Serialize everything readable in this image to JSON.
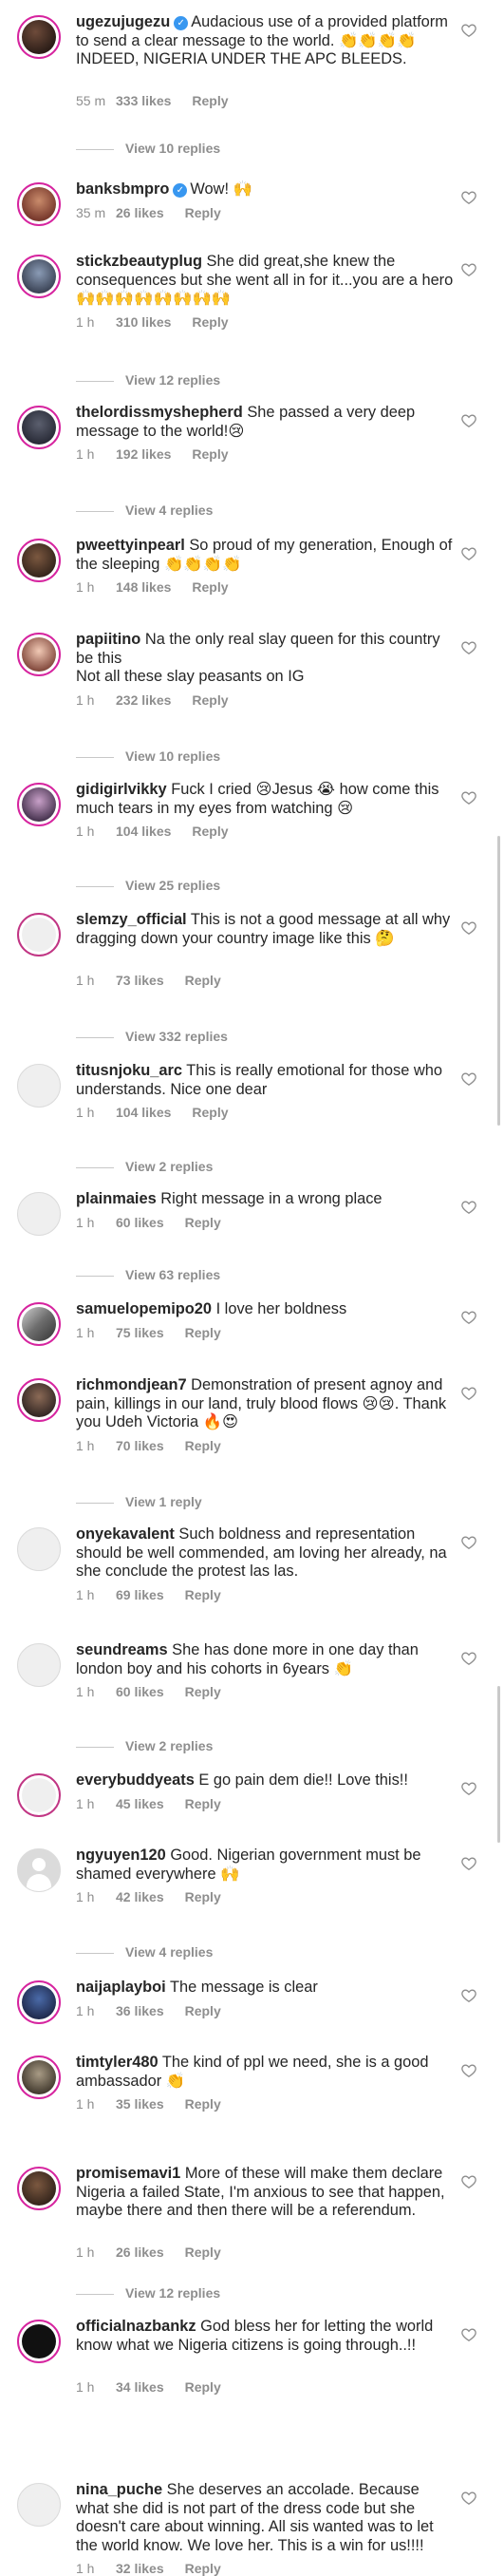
{
  "comments": [
    {
      "username": "ugezujugezu",
      "verified": true,
      "text": "Audacious use of a provided platform to send a clear message to the world. 👏👏👏👏 INDEED, NIGERIA UNDER THE APC BLEEDS.",
      "time": "55 m",
      "likes": "333 likes",
      "reply": "Reply",
      "view_replies": "View 10 replies",
      "avatar": "profile-photo"
    },
    {
      "username": "banksbmpro",
      "verified": true,
      "text": "Wow! 🙌",
      "time": "35 m",
      "likes": "26 likes",
      "reply": "Reply",
      "view_replies": "",
      "avatar": "profile-photo"
    },
    {
      "username": "stickzbeautyplug",
      "verified": false,
      "text": "She did great,she knew the consequences but she went all in for it...you are a hero🙌🙌🙌🙌🙌🙌🙌🙌",
      "time": "1 h",
      "likes": "310 likes",
      "reply": "Reply",
      "view_replies": "View 12 replies",
      "avatar": "profile-photo"
    },
    {
      "username": "thelordissmyshepherd",
      "verified": false,
      "text": "She passed a very deep message to the world!😢",
      "time": "1 h",
      "likes": "192 likes",
      "reply": "Reply",
      "view_replies": "View 4 replies",
      "avatar": "profile-photo"
    },
    {
      "username": "pweettyinpearl",
      "verified": false,
      "text": "So proud of my generation, Enough of the sleeping 👏👏👏👏",
      "time": "1 h",
      "likes": "148 likes",
      "reply": "Reply",
      "view_replies": "",
      "avatar": "profile-photo"
    },
    {
      "username": "papiitino",
      "verified": false,
      "text": "Na the only real slay queen for this country be this\nNot all these slay peasants on IG",
      "time": "1 h",
      "likes": "232 likes",
      "reply": "Reply",
      "view_replies": "View 10 replies",
      "avatar": "profile-photo"
    },
    {
      "username": "gidigirlvikky",
      "verified": false,
      "text": "Fuck I cried 😢Jesus 😭 how come this much tears in my eyes from watching 😢",
      "time": "1 h",
      "likes": "104 likes",
      "reply": "Reply",
      "view_replies": "View 25 replies",
      "avatar": "profile-photo"
    },
    {
      "username": "slemzy_official",
      "verified": false,
      "text": "This is not a good message at all why dragging down your country image like this 🤔",
      "time": "1 h",
      "likes": "73 likes",
      "reply": "Reply",
      "view_replies": "View 332 replies",
      "avatar": "story-ring"
    },
    {
      "username": "titusnjoku_arc",
      "verified": false,
      "text": "This is really emotional for those who understands.  Nice one dear",
      "time": "1 h",
      "likes": "104 likes",
      "reply": "Reply",
      "view_replies": "View 2 replies",
      "avatar": "placeholder"
    },
    {
      "username": "plainmaies",
      "verified": false,
      "text": "Right message in a wrong place",
      "time": "1 h",
      "likes": "60 likes",
      "reply": "Reply",
      "view_replies": "View 63 replies",
      "avatar": "placeholder"
    },
    {
      "username": "samuelopemipo20",
      "verified": false,
      "text": "I love her boldness",
      "time": "1 h",
      "likes": "75 likes",
      "reply": "Reply",
      "view_replies": "",
      "avatar": "profile-photo"
    },
    {
      "username": "richmondjean7",
      "verified": false,
      "text": "Demonstration of present agnoy and pain, killings in our land, truly blood flows 😢😢. Thank you Udeh Victoria 🔥😍",
      "time": "1 h",
      "likes": "70 likes",
      "reply": "Reply",
      "view_replies": "View 1 reply",
      "avatar": "profile-photo"
    },
    {
      "username": "onyekavalent",
      "verified": false,
      "text": "Such boldness and representation should be well commended, am loving her already, na she conclude the protest las las.",
      "time": "1 h",
      "likes": "69 likes",
      "reply": "Reply",
      "view_replies": "",
      "avatar": "placeholder"
    },
    {
      "username": "seundreams",
      "verified": false,
      "text": "She has done more in one day than london boy and his cohorts in 6years 👏",
      "time": "1 h",
      "likes": "60 likes",
      "reply": "Reply",
      "view_replies": "View 2 replies",
      "avatar": "placeholder"
    },
    {
      "username": "everybuddyeats",
      "verified": false,
      "text": "E go pain dem die!! Love this!!",
      "time": "1 h",
      "likes": "45 likes",
      "reply": "Reply",
      "view_replies": "",
      "avatar": "story-ring"
    },
    {
      "username": "ngyuyen120",
      "verified": false,
      "text": "Good. Nigerian government must be shamed everywhere 🙌",
      "time": "1 h",
      "likes": "42 likes",
      "reply": "Reply",
      "view_replies": "View 4 replies",
      "avatar": "default-user"
    },
    {
      "username": "naijaplayboi",
      "verified": false,
      "text": "The message is clear",
      "time": "1 h",
      "likes": "36 likes",
      "reply": "Reply",
      "view_replies": "",
      "avatar": "profile-photo"
    },
    {
      "username": "timtyler480",
      "verified": false,
      "text": "The kind of ppl we need, she is a good ambassador 👏",
      "time": "1 h",
      "likes": "35 likes",
      "reply": "Reply",
      "view_replies": "",
      "avatar": "profile-photo"
    },
    {
      "username": "promisemavi1",
      "verified": false,
      "text": "More of these will make them declare Nigeria a failed State, I'm anxious to see that happen, maybe there and then there will be a referendum.",
      "time": "1 h",
      "likes": "26 likes",
      "reply": "Reply",
      "view_replies": "View 12 replies",
      "avatar": "profile-photo"
    },
    {
      "username": "officialnazbankz",
      "verified": false,
      "text": "God bless her for letting the world know what we Nigeria citizens is going through..!!",
      "time": "1 h",
      "likes": "34 likes",
      "reply": "Reply",
      "view_replies": "",
      "avatar": "profile-photo"
    },
    {
      "username": "nina_puche",
      "verified": false,
      "text": "She deserves an accolade. Because what she did is not part of the dress code but she doesn't care about winning. All sis wanted was to let the world know. We love her. This is a win for us!!!!",
      "time": "1 h",
      "likes": "32 likes",
      "reply": "Reply",
      "view_replies": "",
      "avatar": "placeholder"
    }
  ],
  "icons": {
    "heart": "heart-outline-icon",
    "verified": "verified-badge-icon"
  },
  "colors": {
    "text": "#262626",
    "meta": "#8e8e8e",
    "verified": "#3897f0",
    "story_ring": "#c13584"
  }
}
